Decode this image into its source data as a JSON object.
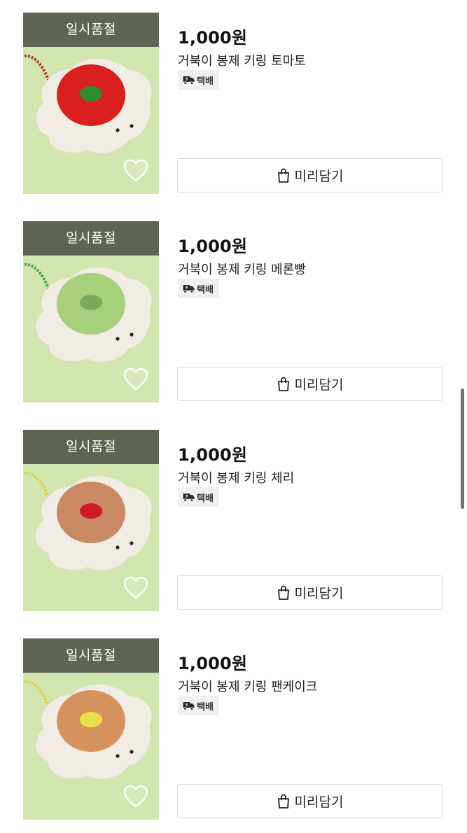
{
  "products": [
    {
      "badge": "일시품절",
      "price": "1,000원",
      "name": "거북이 봉제 키링 토마토",
      "shipping": "택배",
      "cart_label": "미리담기",
      "shell_color": "#d9201d",
      "detail_color": "#2e8b2e",
      "chain_color": "#b3343a"
    },
    {
      "badge": "일시품절",
      "price": "1,000원",
      "name": "거북이 봉제 키링 메론빵",
      "shipping": "택배",
      "cart_label": "미리담기",
      "shell_color": "#a8cf7c",
      "detail_color": "#7fa95a",
      "chain_color": "#3fa64a"
    },
    {
      "badge": "일시품절",
      "price": "1,000원",
      "name": "거북이 봉제 키링 체리",
      "shipping": "택배",
      "cart_label": "미리담기",
      "shell_color": "#c98a63",
      "detail_color": "#d0182a",
      "chain_color": "#d7d43a"
    },
    {
      "badge": "일시품절",
      "price": "1,000원",
      "name": "거북이 봉제 키링 팬케이크",
      "shipping": "택배",
      "cart_label": "미리담기",
      "shell_color": "#d6925c",
      "detail_color": "#e6e24a",
      "chain_color": "#d7d43a"
    }
  ]
}
